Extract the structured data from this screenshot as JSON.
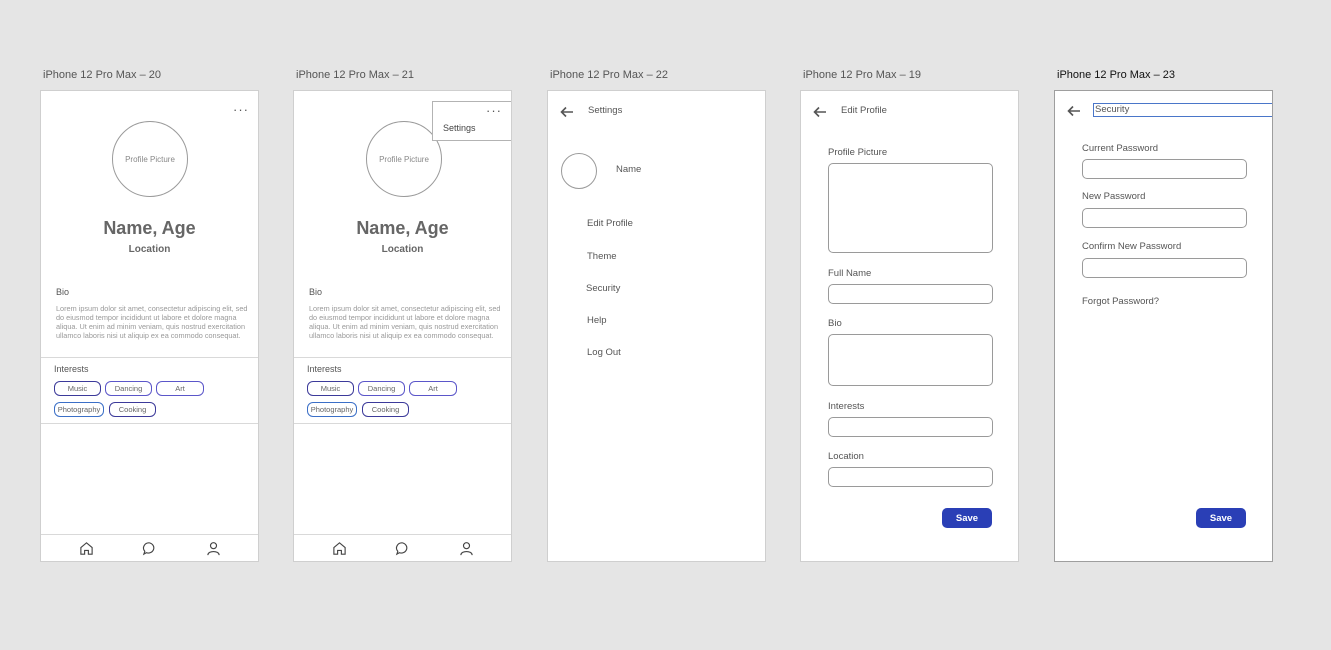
{
  "frames": [
    {
      "label": "iPhone 12 Pro Max – 20"
    },
    {
      "label": "iPhone 12 Pro Max – 21"
    },
    {
      "label": "iPhone 12 Pro Max – 22"
    },
    {
      "label": "iPhone 12 Pro Max – 19"
    },
    {
      "label": "iPhone 12 Pro Max – 23"
    }
  ],
  "profile": {
    "more": "···",
    "picture_placeholder": "Profile Picture",
    "name_age": "Name, Age",
    "location": "Location",
    "bio_label": "Bio",
    "bio_text": "Lorem ipsum dolor sit amet, consectetur adipiscing elit, sed do eiusmod tempor incididunt ut labore et dolore magna aliqua. Ut enim ad minim veniam, quis nostrud exercitation ullamco laboris nisi ut aliquip ex ea commodo consequat.",
    "interests_label": "Interests",
    "interests": [
      "Music",
      "Dancing",
      "Art",
      "Photography",
      "Cooking"
    ],
    "nav": [
      "home-icon",
      "chat-icon",
      "user-icon"
    ]
  },
  "dropdown": {
    "settings": "Settings"
  },
  "settings": {
    "title": "Settings",
    "name": "Name",
    "items": [
      "Edit Profile",
      "Theme",
      "Security",
      "Help",
      "Log Out"
    ]
  },
  "edit_profile": {
    "title": "Edit Profile",
    "profile_picture": "Profile Picture",
    "full_name": "Full Name",
    "bio": "Bio",
    "interests": "Interests",
    "location": "Location",
    "save": "Save"
  },
  "security": {
    "title": "Security",
    "current_password": "Current Password",
    "new_password": "New Password",
    "confirm_password": "Confirm New Password",
    "forgot": "Forgot Password?",
    "save": "Save"
  },
  "colors": {
    "accent": "#2a3fb6",
    "chip_border": "#5b56c9",
    "canvas": "#e5e5e5"
  }
}
